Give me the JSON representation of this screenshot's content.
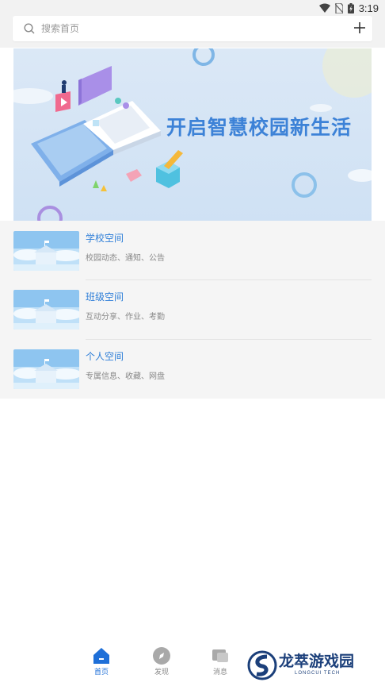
{
  "status": {
    "time": "3:19",
    "wifi_icon": "wifi-icon",
    "sim_icon": "no-sim-icon",
    "battery_icon": "battery-charging-icon"
  },
  "search": {
    "placeholder": "搜索首页",
    "add_icon": "plus-icon"
  },
  "banner": {
    "title": "开启智慧校园新生活"
  },
  "spaces": [
    {
      "title": "学校空间",
      "subtitle": "校园动态、通知、公告"
    },
    {
      "title": "班级空间",
      "subtitle": "互动分享、作业、考勤"
    },
    {
      "title": "个人空间",
      "subtitle": "专属信息、收藏、网盘"
    }
  ],
  "tabs": [
    {
      "label": "首页",
      "icon": "home-icon",
      "active": true
    },
    {
      "label": "发现",
      "icon": "compass-icon",
      "active": false
    },
    {
      "label": "消息",
      "icon": "message-icon",
      "active": false
    }
  ],
  "watermark": {
    "name": "龙萃游戏园",
    "sub": "LONGCUI TECH"
  },
  "colors": {
    "accent": "#2f7fd8",
    "tab_active": "#1e6fd8",
    "background": "#f5f5f5"
  }
}
